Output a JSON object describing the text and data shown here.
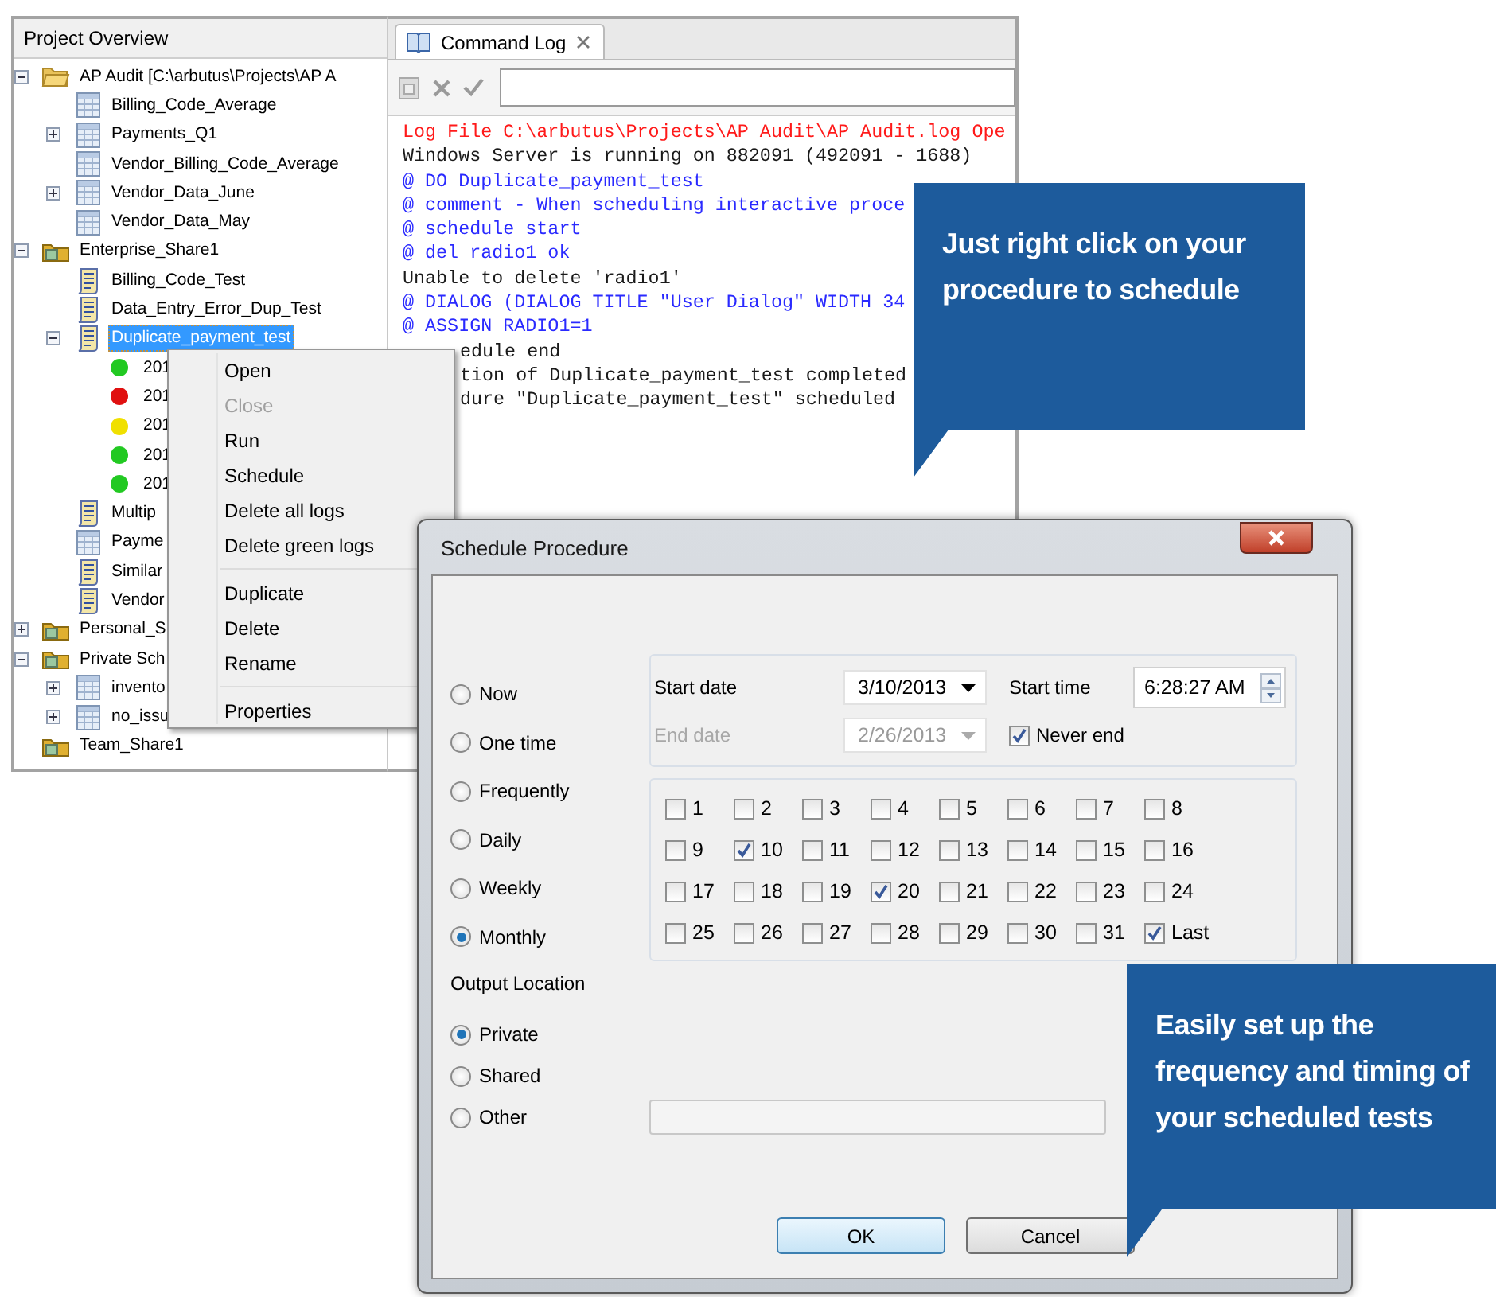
{
  "project_overview": {
    "title": "Project Overview",
    "tree": [
      {
        "label": "AP Audit [C:\\arbutus\\Projects\\AP A",
        "kind": "folder",
        "expanded": true,
        "selected": false,
        "children": [
          {
            "label": "Billing_Code_Average",
            "kind": "table",
            "selected": false
          },
          {
            "label": "Payments_Q1",
            "kind": "table",
            "expanded": false,
            "selected": false
          },
          {
            "label": "Vendor_Billing_Code_Average",
            "kind": "table",
            "selected": false
          },
          {
            "label": "Vendor_Data_June",
            "kind": "table",
            "expanded": false,
            "selected": false
          },
          {
            "label": "Vendor_Data_May",
            "kind": "table",
            "selected": false
          }
        ]
      },
      {
        "label": "Enterprise_Share1",
        "kind": "share",
        "expanded": true,
        "selected": false,
        "children": [
          {
            "label": "Billing_Code_Test",
            "kind": "script",
            "selected": false
          },
          {
            "label": "Data_Entry_Error_Dup_Test",
            "kind": "script",
            "selected": false
          },
          {
            "label": "Duplicate_payment_test",
            "kind": "script",
            "expanded": true,
            "selected": true,
            "children": [
              {
                "label": "201",
                "kind": "log",
                "color": "#22c922",
                "selected": false
              },
              {
                "label": "201",
                "kind": "log",
                "color": "#e01010",
                "selected": false
              },
              {
                "label": "201",
                "kind": "log",
                "color": "#f0e000",
                "selected": false
              },
              {
                "label": "201",
                "kind": "log",
                "color": "#22c922",
                "selected": false
              },
              {
                "label": "201",
                "kind": "log",
                "color": "#22c922",
                "selected": false
              }
            ]
          },
          {
            "label": "Multip",
            "kind": "script",
            "selected": false
          },
          {
            "label": "Payme",
            "kind": "table",
            "selected": false
          },
          {
            "label": "Similar",
            "kind": "script",
            "selected": false
          },
          {
            "label": "Vendor",
            "kind": "script",
            "selected": false
          }
        ]
      },
      {
        "label": "Personal_S",
        "kind": "share",
        "expanded": false,
        "selected": false
      },
      {
        "label": "Private Sch",
        "kind": "share",
        "expanded": true,
        "selected": false,
        "children": [
          {
            "label": "invento",
            "kind": "table",
            "expanded": false,
            "selected": false
          },
          {
            "label": "no_issu",
            "kind": "table",
            "expanded": false,
            "selected": false
          }
        ]
      },
      {
        "label": "Team_Share1",
        "kind": "share",
        "selected": false
      }
    ]
  },
  "command_log": {
    "tab": {
      "label": "Command Log",
      "selected": true
    },
    "lines": [
      {
        "text": "Log File C:\\arbutus\\Projects\\AP Audit\\AP Audit.log Ope",
        "kind": "error"
      },
      {
        "text": "Windows Server is running on 882091 (492091 - 1688)",
        "kind": "output"
      },
      {
        "text": "@ DO Duplicate_payment_test",
        "kind": "command"
      },
      {
        "text": "@ comment - When scheduling interactive proce",
        "kind": "command"
      },
      {
        "text": "@ schedule start",
        "kind": "command"
      },
      {
        "text": "@ del radio1 ok",
        "kind": "command"
      },
      {
        "text": "Unable to delete 'radio1'",
        "kind": "output"
      },
      {
        "text": "@ DIALOG (DIALOG TITLE \"User Dialog\" WIDTH 34",
        "kind": "command"
      },
      {
        "text": "@ ASSIGN RADIO1=1",
        "kind": "command"
      },
      {
        "text": "edule end",
        "kind": "output",
        "hidden_start": true
      },
      {
        "text": "tion of Duplicate_payment_test completed",
        "kind": "output",
        "hidden_start": true
      },
      {
        "text": "dure \"Duplicate_payment_test\" scheduled",
        "kind": "output",
        "hidden_start": true
      }
    ]
  },
  "context_menu": {
    "groups": [
      [
        {
          "label": "Open",
          "disabled": false
        },
        {
          "label": "Close",
          "disabled": true
        },
        {
          "label": "Run",
          "disabled": false
        },
        {
          "label": "Schedule",
          "disabled": false
        },
        {
          "label": "Delete all logs",
          "disabled": false
        },
        {
          "label": "Delete green logs",
          "disabled": false
        }
      ],
      [
        {
          "label": "Duplicate",
          "disabled": false
        },
        {
          "label": "Delete",
          "disabled": false
        },
        {
          "label": "Rename",
          "disabled": false
        }
      ],
      [
        {
          "label": "Properties",
          "disabled": false
        }
      ]
    ]
  },
  "dialog": {
    "title": "Schedule Procedure",
    "frequency": [
      {
        "label": "Now",
        "selected": false
      },
      {
        "label": "One time",
        "selected": false
      },
      {
        "label": "Frequently",
        "selected": false
      },
      {
        "label": "Daily",
        "selected": false
      },
      {
        "label": "Weekly",
        "selected": false
      },
      {
        "label": "Monthly",
        "selected": true
      }
    ],
    "start_date": {
      "label": "Start date",
      "value": "3/10/2013",
      "disabled": false
    },
    "start_time": {
      "label": "Start time",
      "value": "6:28:27 AM"
    },
    "end_date": {
      "label": "End date",
      "value": "2/26/2013",
      "disabled": true
    },
    "never_end": {
      "label": "Never end",
      "checked": true
    },
    "days": [
      {
        "label": "1",
        "checked": false
      },
      {
        "label": "2",
        "checked": false
      },
      {
        "label": "3",
        "checked": false
      },
      {
        "label": "4",
        "checked": false
      },
      {
        "label": "5",
        "checked": false
      },
      {
        "label": "6",
        "checked": false
      },
      {
        "label": "7",
        "checked": false
      },
      {
        "label": "8",
        "checked": false
      },
      {
        "label": "9",
        "checked": false
      },
      {
        "label": "10",
        "checked": true
      },
      {
        "label": "11",
        "checked": false
      },
      {
        "label": "12",
        "checked": false
      },
      {
        "label": "13",
        "checked": false
      },
      {
        "label": "14",
        "checked": false
      },
      {
        "label": "15",
        "checked": false
      },
      {
        "label": "16",
        "checked": false
      },
      {
        "label": "17",
        "checked": false
      },
      {
        "label": "18",
        "checked": false
      },
      {
        "label": "19",
        "checked": false
      },
      {
        "label": "20",
        "checked": true
      },
      {
        "label": "21",
        "checked": false
      },
      {
        "label": "22",
        "checked": false
      },
      {
        "label": "23",
        "checked": false
      },
      {
        "label": "24",
        "checked": false
      },
      {
        "label": "25",
        "checked": false
      },
      {
        "label": "26",
        "checked": false
      },
      {
        "label": "27",
        "checked": false
      },
      {
        "label": "28",
        "checked": false
      },
      {
        "label": "29",
        "checked": false
      },
      {
        "label": "30",
        "checked": false
      },
      {
        "label": "31",
        "checked": false
      },
      {
        "label": "Last",
        "checked": true
      }
    ],
    "output_location": {
      "label": "Output Location",
      "options": [
        {
          "label": "Private",
          "selected": true
        },
        {
          "label": "Shared",
          "selected": false
        },
        {
          "label": "Other",
          "selected": false
        }
      ]
    },
    "buttons": [
      {
        "label": "OK",
        "default": true
      },
      {
        "label": "Cancel",
        "default": false
      }
    ]
  },
  "callouts": [
    {
      "text": "Just right click on your procedure to schedule"
    },
    {
      "text": "Easily set up the frequency and timing of your scheduled tests"
    }
  ]
}
